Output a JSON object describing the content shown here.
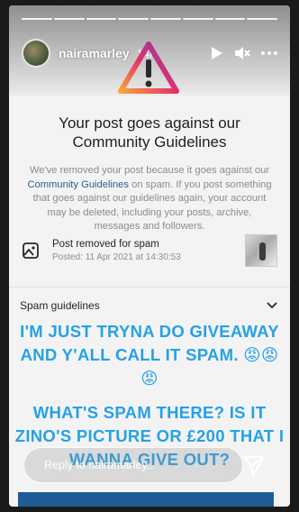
{
  "story": {
    "username": "nairamarley",
    "time_ago": "14h",
    "progress_segments": 8
  },
  "notice": {
    "title": "Your post goes against our Community Guidelines",
    "desc_part1": "We've removed your post because it goes against our",
    "desc_link": "Community Guidelines",
    "desc_part2": "on spam. If you post something that goes against our guidelines again, your account may be deleted, including your posts, archive, messages and followers."
  },
  "removed": {
    "label": "Post removed for spam",
    "posted": "Posted: 11 Apr 2021 at 14:30:53"
  },
  "spam_guidelines_label": "Spam guidelines",
  "captions": {
    "line1": "I'M JUST TRYNA DO GIVEAWAY AND Y'ALL CALL IT SPAM. 😡😡😡",
    "line2": "WHAT'S SPAM THERE? IS IT ZINO'S PICTURE OR £200 THAT I WANNA GIVE OUT?"
  },
  "reply": {
    "placeholder": "Reply to nairamarley..."
  },
  "colors": {
    "caption": "#26a1e6",
    "link": "#2f5b8d"
  },
  "icons": [
    "warning-icon",
    "play-icon",
    "mute-icon",
    "more-icon",
    "image-icon",
    "chevron-down-icon",
    "send-icon"
  ]
}
